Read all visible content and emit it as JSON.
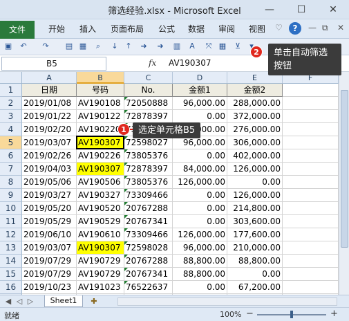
{
  "window": {
    "title": "筛选经验.xlsx - Microsoft Excel"
  },
  "ribbon": {
    "file_tab": "文件",
    "tabs": [
      "开始",
      "插入",
      "页面布局",
      "公式",
      "数据",
      "审阅",
      "视图"
    ]
  },
  "formula_bar": {
    "name_box": "B5",
    "fx_label": "fx",
    "value": "AV190307"
  },
  "columns": [
    "A",
    "B",
    "C",
    "D",
    "E",
    "F"
  ],
  "row_numbers": [
    "1",
    "2",
    "3",
    "4",
    "5",
    "6",
    "7",
    "8",
    "9",
    "10",
    "11",
    "12",
    "13",
    "14",
    "15",
    "16",
    "17"
  ],
  "header_row": [
    "日期",
    "号码",
    "No.",
    "金额1",
    "金额2"
  ],
  "rows": [
    [
      "2019/01/08",
      "AV190108",
      "72050888",
      "96,000.00",
      "288,000.00"
    ],
    [
      "2019/01/22",
      "AV190122",
      "72878397",
      "0.00",
      "372,000.00"
    ],
    [
      "2019/02/20",
      "AV190220",
      "73809813",
      "96,000.00",
      "276,000.00"
    ],
    [
      "2019/03/07",
      "AV190307",
      "72598027",
      "96,000.00",
      "306,000.00"
    ],
    [
      "2019/02/26",
      "AV190226",
      "73805376",
      "0.00",
      "402,000.00"
    ],
    [
      "2019/04/03",
      "AV190307",
      "72878397",
      "84,000.00",
      "126,000.00"
    ],
    [
      "2019/05/06",
      "AV190506",
      "73805376",
      "126,000.00",
      "0.00"
    ],
    [
      "2019/03/27",
      "AV190327",
      "73309466",
      "0.00",
      "126,000.00"
    ],
    [
      "2019/05/20",
      "AV190520",
      "20767288",
      "0.00",
      "214,800.00"
    ],
    [
      "2019/05/29",
      "AV190529",
      "20767341",
      "0.00",
      "303,600.00"
    ],
    [
      "2019/06/10",
      "AV190610",
      "73309466",
      "126,000.00",
      "177,600.00"
    ],
    [
      "2019/03/07",
      "AV190307",
      "72598028",
      "96,000.00",
      "210,000.00"
    ],
    [
      "2019/07/29",
      "AV190729",
      "20767288",
      "88,800.00",
      "88,800.00"
    ],
    [
      "2019/07/29",
      "AV190729",
      "20767341",
      "88,800.00",
      "0.00"
    ],
    [
      "2019/10/23",
      "AV191023",
      "76522637",
      "0.00",
      "67,200.00"
    ]
  ],
  "sheets": [
    "Sheet1"
  ],
  "status": {
    "mode": "就绪",
    "zoom": "100%"
  },
  "annotations": {
    "step1_number": "1",
    "step1_text": "选定单元格B5",
    "step2_number": "2",
    "step2_text_line1": "单击自动筛选",
    "step2_text_line2": "按钮"
  },
  "colors": {
    "highlight": "#ffff00",
    "file_tab": "#2a7a3b",
    "badge": "#e0281e",
    "callout_bg": "#3b3b3b"
  }
}
